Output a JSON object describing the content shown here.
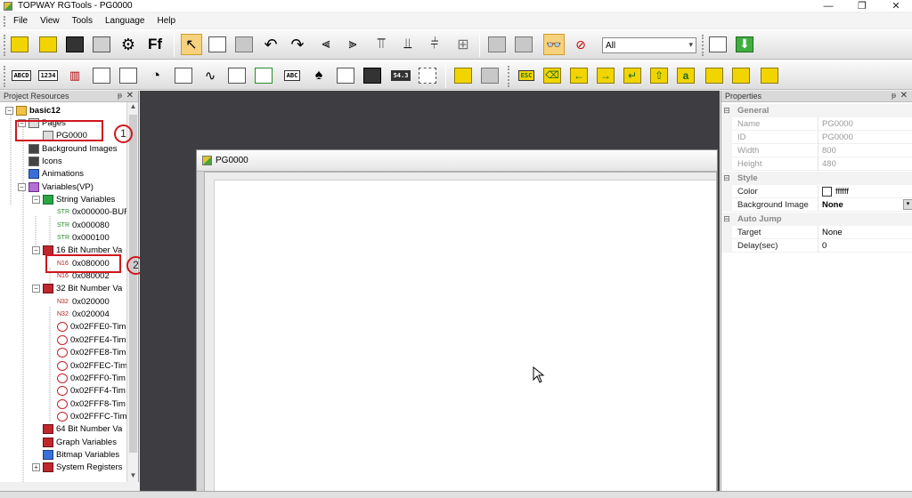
{
  "window": {
    "title": "TOPWAY RGTools - PG0000",
    "minimize": "—",
    "maximize": "❐",
    "close": "✕"
  },
  "menubar": {
    "items": [
      "File",
      "View",
      "Tools",
      "Language",
      "Help"
    ]
  },
  "toolbar": {
    "filter_value": "All",
    "toggle_label": "Ff",
    "buttons2": [
      "ABCD",
      "1234",
      "ESC",
      "a",
      "54.3"
    ]
  },
  "left_panel": {
    "title": "Project Resources",
    "pin": "ᵽ",
    "close": "✕",
    "tree": [
      {
        "label": "basic12",
        "level": 0
      },
      {
        "label": "Pages",
        "level": 1
      },
      {
        "label": "PG0000",
        "level": 2
      },
      {
        "label": "Background Images",
        "level": 1
      },
      {
        "label": "Icons",
        "level": 1
      },
      {
        "label": "Animations",
        "level": 1
      },
      {
        "label": "Variables(VP)",
        "level": 1
      },
      {
        "label": "String Variables",
        "level": 2
      },
      {
        "label": "0x000000-BUF",
        "level": 3,
        "tag": "STR"
      },
      {
        "label": "0x000080",
        "level": 3,
        "tag": "STR"
      },
      {
        "label": "0x000100",
        "level": 3,
        "tag": "STR"
      },
      {
        "label": "16 Bit Number Va",
        "level": 2
      },
      {
        "label": "0x080000",
        "level": 3,
        "tag": "N16"
      },
      {
        "label": "0x080002",
        "level": 3,
        "tag": "N16"
      },
      {
        "label": "32 Bit Number Va",
        "level": 2
      },
      {
        "label": "0x020000",
        "level": 3,
        "tag": "N32"
      },
      {
        "label": "0x020004",
        "level": 3,
        "tag": "N32"
      },
      {
        "label": "0x02FFE0-Tim",
        "level": 3
      },
      {
        "label": "0x02FFE4-Tim",
        "level": 3
      },
      {
        "label": "0x02FFE8-Tim",
        "level": 3
      },
      {
        "label": "0x02FFEC-Tim",
        "level": 3
      },
      {
        "label": "0x02FFF0-Tim",
        "level": 3
      },
      {
        "label": "0x02FFF4-Tim",
        "level": 3
      },
      {
        "label": "0x02FFF8-Tim",
        "level": 3
      },
      {
        "label": "0x02FFFC-Tim",
        "level": 3
      },
      {
        "label": "64 Bit Number Va",
        "level": 2
      },
      {
        "label": "Graph Variables",
        "level": 2
      },
      {
        "label": "Bitmap Variables",
        "level": 2
      },
      {
        "label": "System Registers",
        "level": 2
      }
    ],
    "tags": {
      "str": "STR",
      "n16": "N16",
      "n32": "N32"
    },
    "markers": [
      "1",
      "2"
    ]
  },
  "document": {
    "title": "PG0000"
  },
  "properties": {
    "title": "Properties",
    "pin": "ᵽ",
    "close": "✕",
    "categories": {
      "general": "General",
      "style": "Style",
      "auto_jump": "Auto Jump"
    },
    "rows": {
      "name": {
        "label": "Name",
        "value": "PG0000"
      },
      "id": {
        "label": "ID",
        "value": "PG0000"
      },
      "width": {
        "label": "Width",
        "value": "800"
      },
      "height": {
        "label": "Height",
        "value": "480"
      },
      "color": {
        "label": "Color",
        "value": "ffffff"
      },
      "bg_image": {
        "label": "Background Image",
        "value": "None"
      },
      "target": {
        "label": "Target",
        "value": "None"
      },
      "delay": {
        "label": "Delay(sec)",
        "value": "0"
      }
    },
    "toggle_minus": "⊟"
  },
  "colors": {
    "workspace": "#3e3e42",
    "annotation": "#d0151d",
    "accent_active": "#f7d27c"
  }
}
